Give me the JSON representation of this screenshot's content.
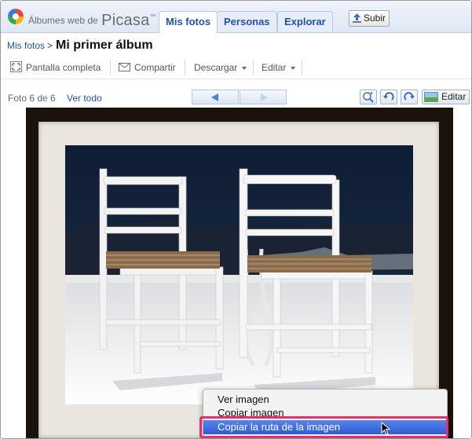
{
  "header": {
    "brand_small": "Álbumes web de",
    "brand_big": "Picasa",
    "brand_tm": "™",
    "tabs": [
      {
        "label": "Mis fotos",
        "active": true
      },
      {
        "label": "Personas",
        "active": false
      },
      {
        "label": "Explorar",
        "active": false
      }
    ],
    "upload_label": "Subir"
  },
  "breadcrumb": {
    "parent": "Mis fotos",
    "separator": ">",
    "title": "Mi primer álbum"
  },
  "toolbar": {
    "fullscreen": "Pantalla completa",
    "share": "Compartir",
    "download": "Descargar",
    "edit": "Editar"
  },
  "viewer": {
    "counter": "Foto 6 de 6",
    "view_all": "Ver todo",
    "edit_button": "Editar",
    "icons": [
      "zoom-icon",
      "rotate-left-icon",
      "rotate-right-icon"
    ]
  },
  "context_menu": {
    "items": [
      {
        "label": "Ver imagen"
      },
      {
        "label": "Copiar imagen"
      },
      {
        "label": "Copiar la ruta de la imagen",
        "selected": true
      }
    ]
  },
  "colors": {
    "link": "#2152a5",
    "highlight": "#e0306f",
    "menu_selection": "#2d5bd6"
  }
}
